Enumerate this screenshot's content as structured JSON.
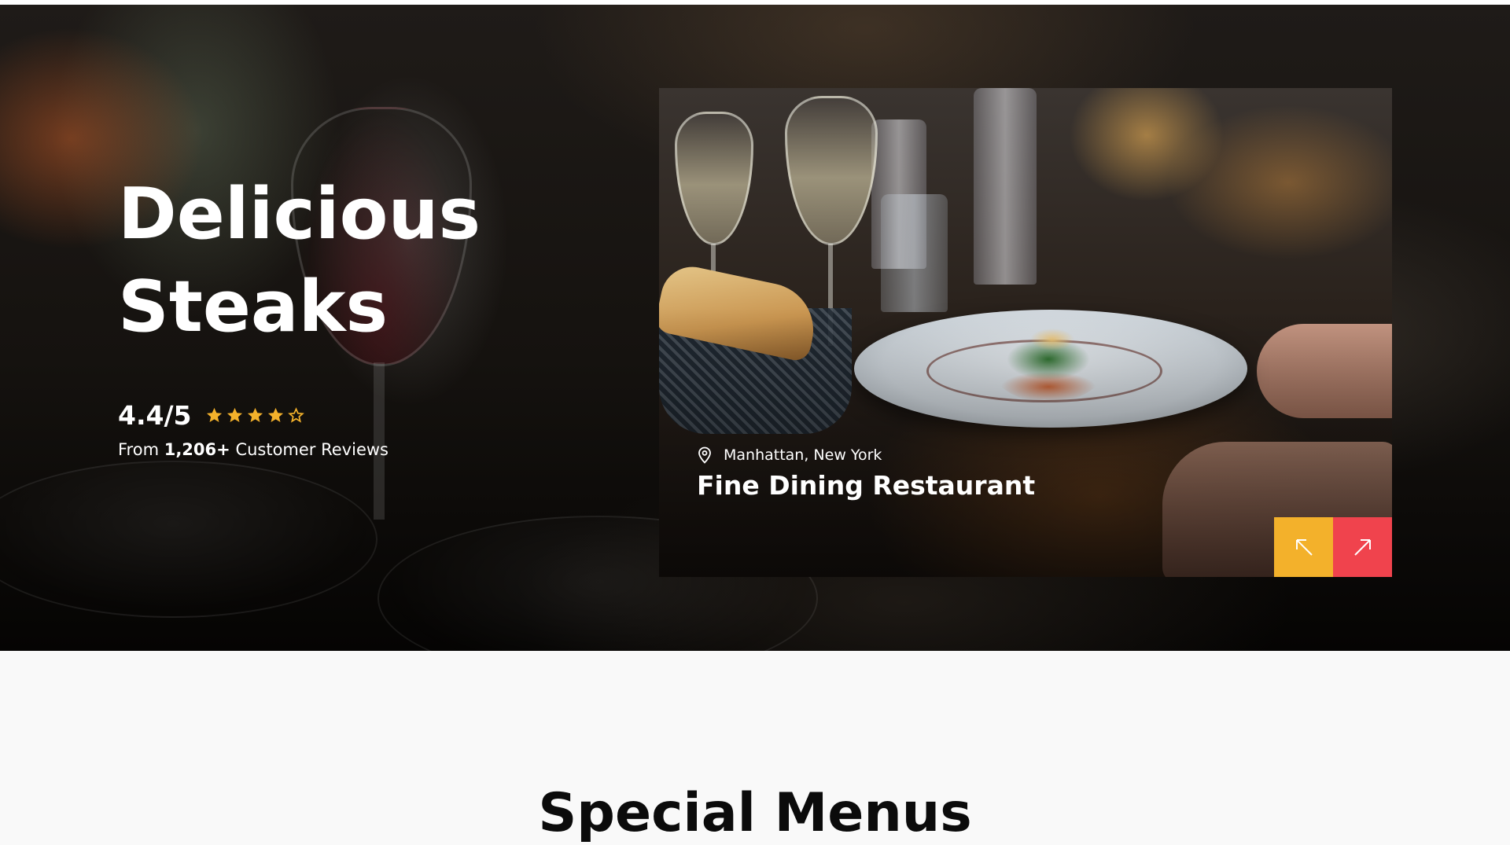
{
  "hero": {
    "title_line1": "Delicious",
    "title_line2": "Steaks",
    "rating_value": "4.4/5",
    "rating_stars_filled": 4,
    "rating_stars_total": 5,
    "reviews_prefix": "From",
    "reviews_count": "1,206+",
    "reviews_suffix": "Customer Reviews",
    "star_color": "#f3b12b"
  },
  "card": {
    "location": "Manhattan, New York",
    "name": "Fine Dining Restaurant",
    "location_icon": "map-pin-icon",
    "prev_icon": "arrow-up-left-icon",
    "next_icon": "arrow-up-right-icon",
    "prev_color": "#f3b12b",
    "next_color": "#f0434d"
  },
  "section": {
    "title": "Special Menus"
  }
}
